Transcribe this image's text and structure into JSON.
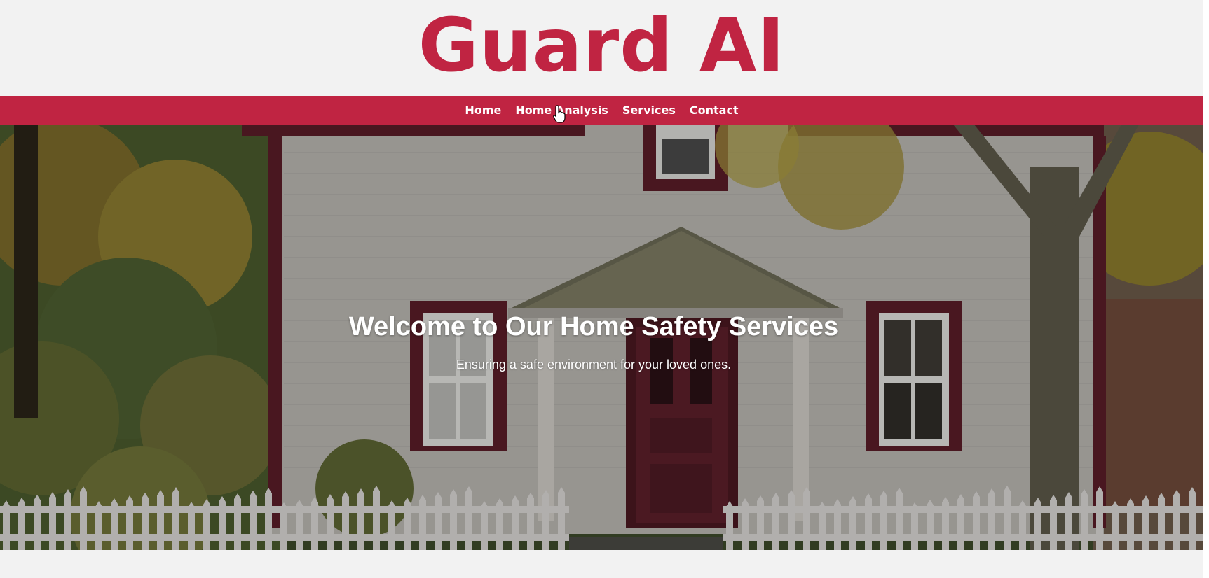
{
  "brand": {
    "name": "Guard AI",
    "color": "#c02442"
  },
  "nav": {
    "items": [
      {
        "label": "Home",
        "active": false
      },
      {
        "label": "Home Analysis",
        "active": true
      },
      {
        "label": "Services",
        "active": false
      },
      {
        "label": "Contact",
        "active": false
      }
    ]
  },
  "hero": {
    "title": "Welcome to Our Home Safety Services",
    "subtitle": "Ensuring a safe environment for your loved ones.",
    "image_subject": "white house with red trim, picket fence and autumn trees"
  },
  "cursor": {
    "icon": "hand-pointer-icon"
  }
}
